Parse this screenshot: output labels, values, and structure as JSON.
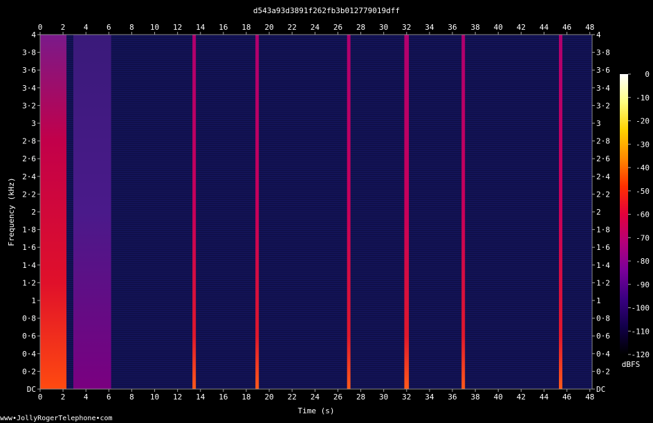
{
  "chart_data": {
    "type": "heatmap",
    "title": "d543a93d3891f262fb3b012779019dff",
    "xlabel": "Time (s)",
    "ylabel": "Frequency (kHz)",
    "xlim": [
      0,
      48.2
    ],
    "ylim": [
      0,
      4
    ],
    "x_ticks": [
      "0",
      "2",
      "4",
      "6",
      "8",
      "10",
      "12",
      "14",
      "16",
      "18",
      "20",
      "22",
      "24",
      "26",
      "28",
      "30",
      "32",
      "34",
      "36",
      "38",
      "40",
      "42",
      "44",
      "46",
      "48"
    ],
    "y_ticks": [
      "DC",
      "0·2",
      "0·4",
      "0·6",
      "0·8",
      "1",
      "1·2",
      "1·4",
      "1·6",
      "1·8",
      "2",
      "2·2",
      "2·4",
      "2·6",
      "2·8",
      "3",
      "3·2",
      "3·4",
      "3·6",
      "3·8",
      "4"
    ],
    "colorbar": {
      "label": "dBFS",
      "ticks": [
        "0",
        "-10",
        "-20",
        "-30",
        "-40",
        "-50",
        "-60",
        "-70",
        "-80",
        "-90",
        "-100",
        "-110",
        "-120"
      ],
      "range": [
        -120,
        0
      ],
      "colors": [
        "#000000",
        "#12004a",
        "#3a0082",
        "#7a009a",
        "#b5007a",
        "#e3003c",
        "#ff3000",
        "#ff8a00",
        "#ffd200",
        "#ffff80",
        "#ffffff"
      ]
    },
    "background_dbfs": -105,
    "events": [
      {
        "start": 0.0,
        "end": 2.3,
        "level_dbfs": -50,
        "kind": "broadband speech"
      },
      {
        "start": 2.9,
        "end": 6.2,
        "level_dbfs": -82,
        "kind": "broadband tone"
      },
      {
        "start": 13.3,
        "end": 13.6,
        "level_dbfs": -55,
        "kind": "ring burst"
      },
      {
        "start": 18.8,
        "end": 19.1,
        "level_dbfs": -62,
        "kind": "ring burst"
      },
      {
        "start": 26.8,
        "end": 27.1,
        "level_dbfs": -58,
        "kind": "ring burst"
      },
      {
        "start": 31.8,
        "end": 32.2,
        "level_dbfs": -52,
        "kind": "ring burst"
      },
      {
        "start": 36.8,
        "end": 37.1,
        "level_dbfs": -55,
        "kind": "ring burst"
      },
      {
        "start": 45.3,
        "end": 45.6,
        "level_dbfs": -60,
        "kind": "ring burst"
      }
    ],
    "grid": false
  },
  "footer": {
    "site": "www•JollyRogerTelephone•com"
  }
}
